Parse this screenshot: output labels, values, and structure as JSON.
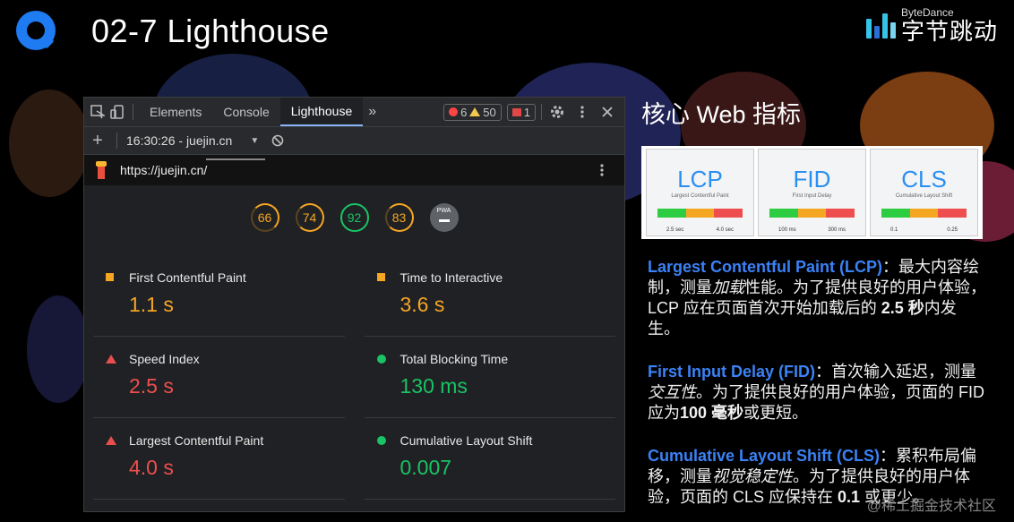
{
  "slide": {
    "title": "02-7 Lighthouse",
    "brand_en": "ByteDance",
    "brand_cn": "字节跳动"
  },
  "devtools": {
    "tabs": [
      "Elements",
      "Console",
      "Lighthouse"
    ],
    "more": "»",
    "errors": "6",
    "warnings": "50",
    "issues": "1",
    "report_label": "16:30:26 - juejin.cn",
    "url": "https://juejin.cn/",
    "scores": [
      "66",
      "74",
      "92",
      "83"
    ],
    "pwa_label": "PWA",
    "colors": {
      "orange": "#f5a623",
      "green": "#18c464",
      "red": "#ef4e4e"
    },
    "metrics": [
      {
        "label": "First Contentful Paint",
        "value": "1.1 s",
        "status": "orange"
      },
      {
        "label": "Time to Interactive",
        "value": "3.6 s",
        "status": "orange"
      },
      {
        "label": "Speed Index",
        "value": "2.5 s",
        "status": "red"
      },
      {
        "label": "Total Blocking Time",
        "value": "130 ms",
        "status": "green"
      },
      {
        "label": "Largest Contentful Paint",
        "value": "4.0 s",
        "status": "red"
      },
      {
        "label": "Cumulative Layout Shift",
        "value": "0.007",
        "status": "green"
      }
    ]
  },
  "web_vitals": {
    "title": "核心 Web 指标",
    "cards": [
      {
        "abbr": "LCP",
        "caption": "Largest Contentful Paint",
        "good": "GOOD",
        "mid": "NEEDS IMPROVEMENT",
        "poor": "POOR",
        "t1": "2.5 sec",
        "t2": "4.0 sec"
      },
      {
        "abbr": "FID",
        "caption": "First Input Delay",
        "good": "GOOD",
        "mid": "NEEDS IMPROVEMENT",
        "poor": "POOR",
        "t1": "100 ms",
        "t2": "300 ms"
      },
      {
        "abbr": "CLS",
        "caption": "Cumulative Layout Shift",
        "good": "GOOD",
        "mid": "NEEDS IMPROVEMENT",
        "poor": "POOR",
        "t1": "0.1",
        "t2": "0.25"
      }
    ],
    "lcp": {
      "name": "Largest Contentful Paint (LCP)",
      "sep": "：",
      "t1": "最大内容绘制，测量",
      "em": "加载",
      "t2": "性能。为了提供良好的用户体验，LCP 应在页面首次开始加载后的 ",
      "strong": "2.5 秒",
      "t3": "内发生。"
    },
    "fid": {
      "name": "First Input Delay (FID)",
      "sep": "：",
      "t1": "首次输入延迟，测量",
      "em": "交互性",
      "t2": "。为了提供良好的用户体验，页面的 FID 应为",
      "strong": "100 毫秒",
      "t3": "或更短。"
    },
    "cls": {
      "name": "Cumulative Layout Shift (CLS)",
      "sep": "：",
      "t1": "累积布局偏移，测量",
      "em": "视觉稳定性",
      "t2": "。为了提供良好的用户体验，页面的 CLS 应保持在 ",
      "strong": "0.1",
      "t3": " 或更少。"
    }
  },
  "watermark": "@稀土掘金技术社区"
}
